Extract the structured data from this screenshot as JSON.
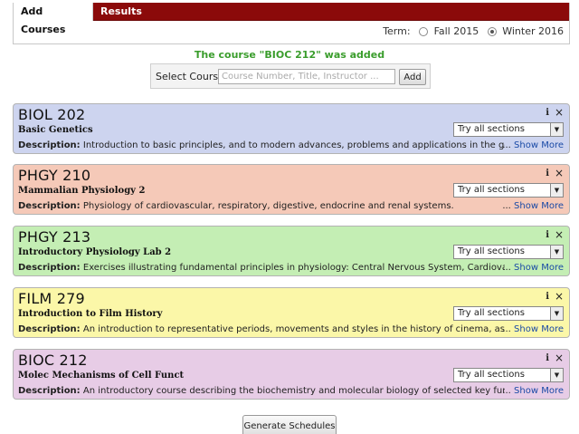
{
  "tabs": [
    {
      "label": "Add Courses"
    },
    {
      "label": "Results"
    }
  ],
  "term": {
    "label": "Term:",
    "options": [
      {
        "label": "Fall 2015",
        "selected": false
      },
      {
        "label": "Winter 2016",
        "selected": true
      }
    ]
  },
  "status_message": "The course \"BIOC 212\" was added",
  "select_course": {
    "label": "Select Course",
    "placeholder": "Course Number, Title, Instructor ...",
    "add_label": "Add"
  },
  "section_select_value": "Try all sections",
  "description_label": "Description:",
  "show_more_ellipsis": "...",
  "show_more_label": "Show More",
  "info_glyph": "i",
  "close_glyph": "×",
  "courses": [
    {
      "code": "BIOL 202",
      "name": "Basic Genetics",
      "description": "Introduction to basic principles, and to modern advances, problems and applications in the genet",
      "color": "#cdd4ef"
    },
    {
      "code": "PHGY 210",
      "name": "Mammalian Physiology 2",
      "description": "Physiology of cardiovascular, respiratory, digestive, endocrine and renal systems.",
      "color": "#f5c9b8"
    },
    {
      "code": "PHGY 213",
      "name": "Introductory Physiology Lab 2",
      "description": "Exercises illustrating fundamental principles in physiology: Central Nervous System, Cardiovascul",
      "color": "#c4eeb4"
    },
    {
      "code": "FILM 279",
      "name": "Introduction to Film History",
      "description": "An introduction to representative periods, movements and styles in the history of cinema, as wel",
      "color": "#fbf7a8"
    },
    {
      "code": "BIOC 212",
      "name": "Molec Mechanisms of Cell Funct",
      "description": "An introductory course describing the biochemistry and molecular biology of selected key function",
      "color": "#e7cce6"
    }
  ],
  "generate_label": "Generate Schedules"
}
